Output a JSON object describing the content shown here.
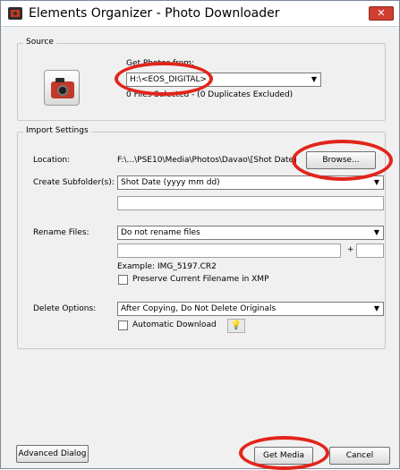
{
  "window": {
    "title": "Elements Organizer - Photo Downloader"
  },
  "source": {
    "group_label": "Source",
    "get_photos_label": "Get Photos from:",
    "device_value": "H:\\<EOS_DIGITAL>",
    "status_text": "0 Files Selected - (0 Duplicates Excluded)"
  },
  "import_settings": {
    "group_label": "Import Settings",
    "location_label": "Location:",
    "location_value": "F:\\...\\PSE10\\Media\\Photos\\Davao\\[Shot Date]",
    "browse_label": "Browse...",
    "subfolder_label": "Create Subfolder(s):",
    "subfolder_value": "Shot Date (yyyy mm dd)",
    "rename_label": "Rename Files:",
    "rename_value": "Do not rename files",
    "plus_sign": "+",
    "example_text": "Example: IMG_5197.CR2",
    "preserve_label": "Preserve Current Filename in XMP",
    "delete_label": "Delete Options:",
    "delete_value": "After Copying, Do Not Delete Originals",
    "auto_download_label": "Automatic Download"
  },
  "footer": {
    "advanced_label": "Advanced Dialog",
    "get_media_label": "Get Media",
    "cancel_label": "Cancel"
  },
  "colors": {
    "annotation_ring": "#e1251b",
    "close_button": "#cf3e2f"
  }
}
